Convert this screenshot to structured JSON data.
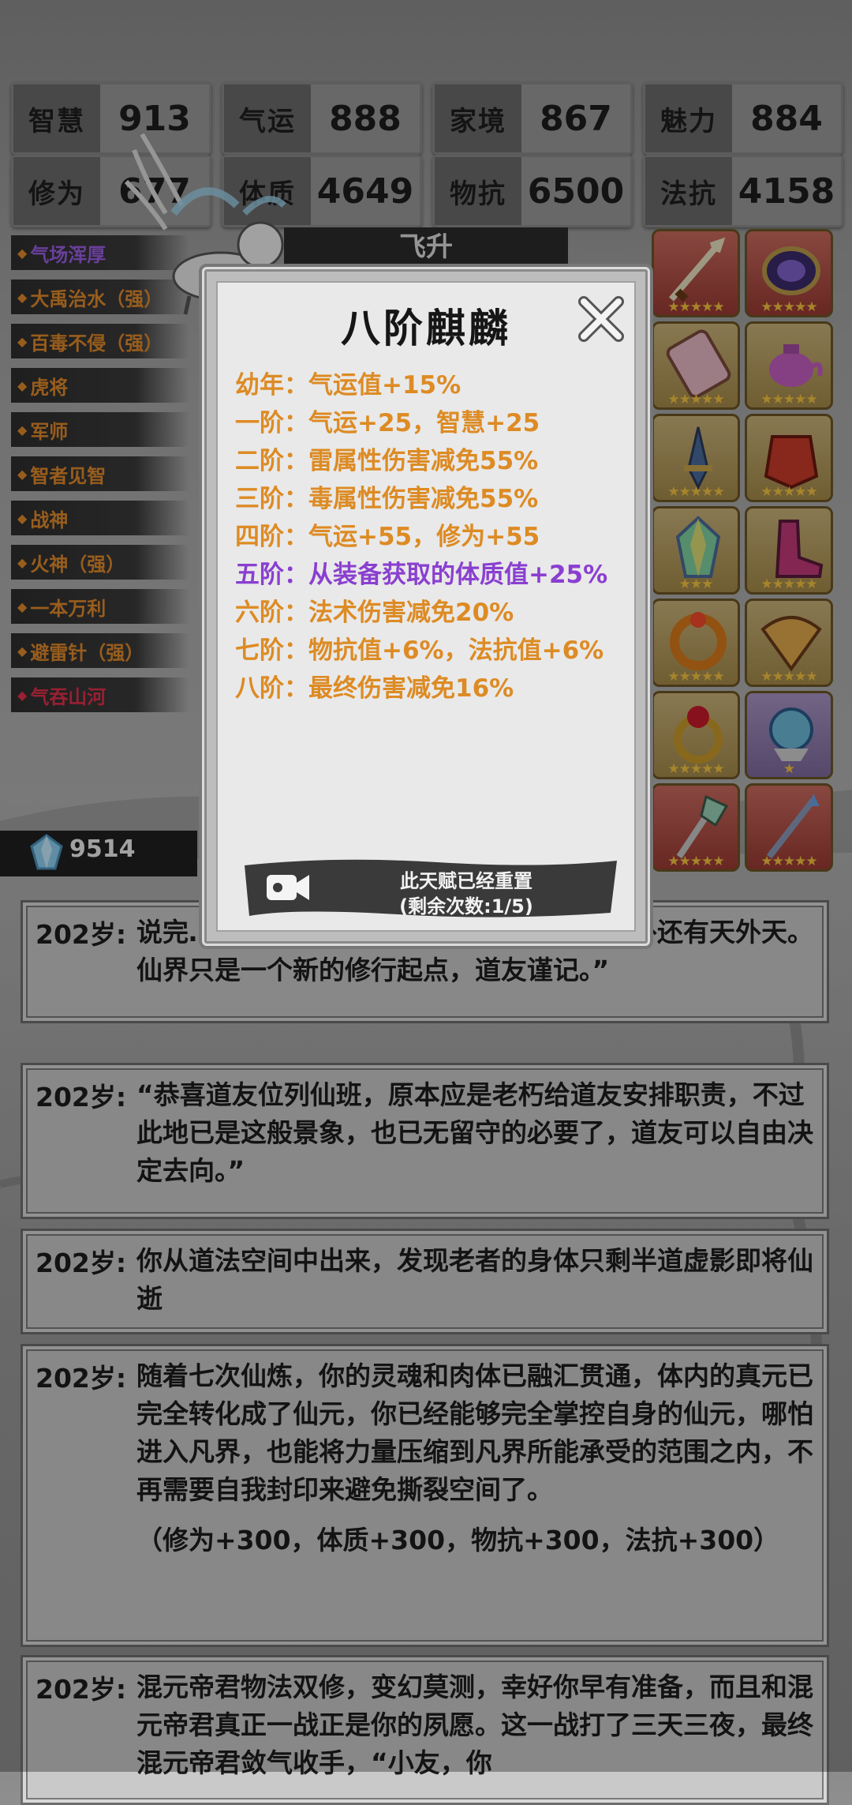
{
  "stats": [
    {
      "label": "智慧",
      "value": "913"
    },
    {
      "label": "气运",
      "value": "888"
    },
    {
      "label": "家境",
      "value": "867"
    },
    {
      "label": "魅力",
      "value": "884"
    },
    {
      "label": "修为",
      "value": "677"
    },
    {
      "label": "体质",
      "value": "4649"
    },
    {
      "label": "物抗",
      "value": "6500"
    },
    {
      "label": "法抗",
      "value": "4158"
    }
  ],
  "talents": [
    {
      "name": "气场浑厚",
      "color": "#9b5de5"
    },
    {
      "name": "大禹治水（强）",
      "color": "#e08a2b"
    },
    {
      "name": "百毒不侵（强）",
      "color": "#e08a2b"
    },
    {
      "name": "虎将",
      "color": "#e08a2b"
    },
    {
      "name": "军师",
      "color": "#e08a2b"
    },
    {
      "name": "智者见智",
      "color": "#e08a2b"
    },
    {
      "name": "战神",
      "color": "#e08a2b"
    },
    {
      "name": "火神（强）",
      "color": "#e08a2b"
    },
    {
      "name": "一本万利",
      "color": "#e08a2b"
    },
    {
      "name": "避雷针（强）",
      "color": "#e08a2b"
    },
    {
      "name": "气吞山河",
      "color": "#e0304a"
    }
  ],
  "flyup_label": "飞升",
  "equipment": [
    {
      "icon": "sword-icon",
      "bg": "red",
      "stars": "★★★★★"
    },
    {
      "icon": "mirror-icon",
      "bg": "red",
      "stars": "★★★★★"
    },
    {
      "icon": "scroll-icon",
      "bg": "gold",
      "stars": "★★★★★"
    },
    {
      "icon": "teapot-icon",
      "bg": "gold",
      "stars": "★★★★★"
    },
    {
      "icon": "dagger-icon",
      "bg": "gold",
      "stars": "★★★★★"
    },
    {
      "icon": "armor-icon",
      "bg": "gold",
      "stars": "★★★★★"
    },
    {
      "icon": "crystal-icon",
      "bg": "gold",
      "stars": "★★★"
    },
    {
      "icon": "boots-icon",
      "bg": "gold",
      "stars": "★★★★★"
    },
    {
      "icon": "ring-icon",
      "bg": "gold",
      "stars": "★★★★★"
    },
    {
      "icon": "fan-icon",
      "bg": "gold",
      "stars": "★★★★★"
    },
    {
      "icon": "gem-ring-icon",
      "bg": "gold",
      "stars": "★★★★★"
    },
    {
      "icon": "orb-icon",
      "bg": "purple",
      "stars": "★"
    },
    {
      "icon": "axe-icon",
      "bg": "red",
      "stars": "★★★★★"
    },
    {
      "icon": "spear-icon",
      "bg": "red",
      "stars": "★★★★★"
    }
  ],
  "currency": {
    "icon": "crystal-currency-icon",
    "value": "9514"
  },
  "dialog": {
    "title": "八阶麒麟",
    "lines": [
      {
        "text": "幼年：气运值+15%",
        "color": "orange"
      },
      {
        "text": "一阶：气运+25，智慧+25",
        "color": "orange"
      },
      {
        "text": "二阶：雷属性伤害减免55%",
        "color": "orange"
      },
      {
        "text": "三阶：毒属性伤害减免55%",
        "color": "orange"
      },
      {
        "text": "四阶：气运+55，修为+55",
        "color": "orange"
      },
      {
        "text": "五阶：从装备获取的体质值+25%",
        "color": "purple"
      },
      {
        "text": "六阶：法术伤害减免20%",
        "color": "orange"
      },
      {
        "text": "七阶：物抗值+6%，法抗值+6%",
        "color": "orange"
      },
      {
        "text": "八阶：最终伤害减免16%",
        "color": "orange"
      }
    ],
    "reset_line1": "此天赋已经重置",
    "reset_line2": "(剩余次数:1/5)"
  },
  "log": [
    {
      "age": "202岁:",
      "text": "说完……有灵界，灵界之上有仙界，仙界之外还有天外天。仙界只是一个新的修行起点，道友谨记。”"
    },
    {
      "age": "202岁:",
      "text": "“恭喜道友位列仙班，原本应是老朽给道友安排职责，不过此地已是这般景象，也已无留守的必要了，道友可以自由决定去向。”"
    },
    {
      "age": "202岁:",
      "text": "你从道法空间中出来，发现老者的身体只剩半道虚影即将仙逝"
    },
    {
      "age": "202岁:",
      "text": "随着七次仙炼，你的灵魂和肉体已融汇贯通，体内的真元已完全转化成了仙元，你已经能够完全掌控自身的仙元，哪怕进入凡界，也能将力量压缩到凡界所能承受的范围之内，不再需要自我封印来避免撕裂空间了。",
      "extra": "（修为+300，体质+300，物抗+300，法抗+300）"
    },
    {
      "age": "202岁:",
      "text": "混元帝君物法双修，变幻莫测，幸好你早有准备，而且和混元帝君真正一战正是你的夙愿。这一战打了三天三夜，最终混元帝君敛气收手，“小友，你"
    }
  ]
}
